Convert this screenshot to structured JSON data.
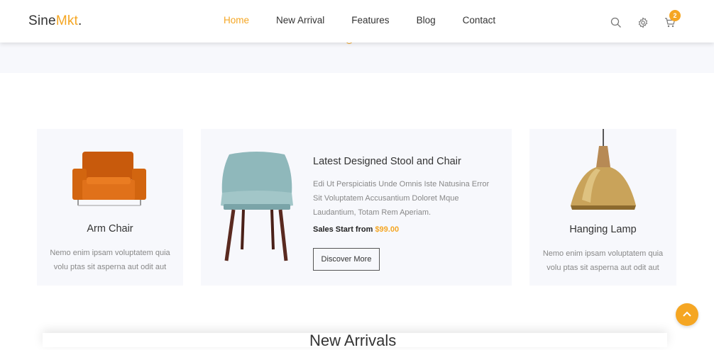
{
  "logo": {
    "prefix": "Sine",
    "accent": "Mkt",
    "suffix": "."
  },
  "nav": {
    "items": [
      {
        "label": "Home",
        "active": true
      },
      {
        "label": "New Arrival",
        "active": false
      },
      {
        "label": "Features",
        "active": false
      },
      {
        "label": "Blog",
        "active": false
      },
      {
        "label": "Contact",
        "active": false
      }
    ]
  },
  "header_icons": {
    "search": "search-icon",
    "settings": "gear-icon",
    "cart": "cart-icon",
    "cart_count": "2"
  },
  "colors": {
    "accent": "#f5a623",
    "card_bg": "#f7f8fc",
    "text": "#333333",
    "muted": "#888888"
  },
  "cards": {
    "left": {
      "title": "Arm Chair",
      "desc": "Nemo enim ipsam voluptatem quia volu ptas sit asperna aut odit aut"
    },
    "middle": {
      "title": "Latest Designed Stool and Chair",
      "desc": "Edi Ut Perspiciatis Unde Omnis Iste Natusina Error Sit Voluptatem Accusantium Doloret Mque Laudantium, Totam Rem Aperiam.",
      "sale_label": "Sales Start from",
      "price": "$99.00",
      "button": "Discover More"
    },
    "right": {
      "title": "Hanging Lamp",
      "desc": "Nemo enim ipsam voluptatem quia volu ptas sit asperna aut odit aut"
    }
  },
  "section_heading": "New Arrivals",
  "scroll_top_icon": "chevron-up-icon"
}
